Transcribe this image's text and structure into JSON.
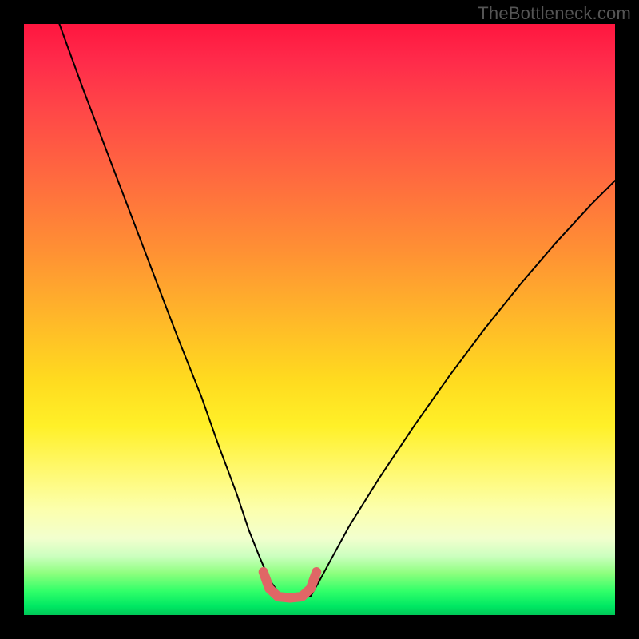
{
  "watermark": "TheBottleneck.com",
  "chart_data": {
    "type": "line",
    "title": "",
    "xlabel": "",
    "ylabel": "",
    "xlim": [
      0,
      100
    ],
    "ylim": [
      0,
      100
    ],
    "series": [
      {
        "name": "bottleneck-curve",
        "x": [
          6,
          10,
          14,
          18,
          22,
          26,
          30,
          33,
          36,
          38,
          40,
          41.5,
          43.5,
          46.5,
          48.5,
          50,
          52,
          55,
          60,
          66,
          72,
          78,
          84,
          90,
          96,
          100
        ],
        "values": [
          100,
          89,
          78.5,
          68,
          57.5,
          47,
          37,
          28.5,
          20.5,
          14.5,
          9.5,
          6,
          3.2,
          3.0,
          3.2,
          5.8,
          9.5,
          15,
          23,
          32,
          40.5,
          48.5,
          56,
          63,
          69.5,
          73.5
        ]
      },
      {
        "name": "flat-bottom-highlight",
        "x": [
          40.5,
          41.5,
          43,
          45,
          47,
          48.5,
          49.5
        ],
        "values": [
          7.3,
          4.5,
          3.1,
          2.9,
          3.1,
          4.5,
          7.3
        ]
      }
    ],
    "colors": {
      "curve": "#000000",
      "highlight": "#e06666",
      "gradient_top": "#ff163f",
      "gradient_bottom": "#00c858"
    }
  }
}
